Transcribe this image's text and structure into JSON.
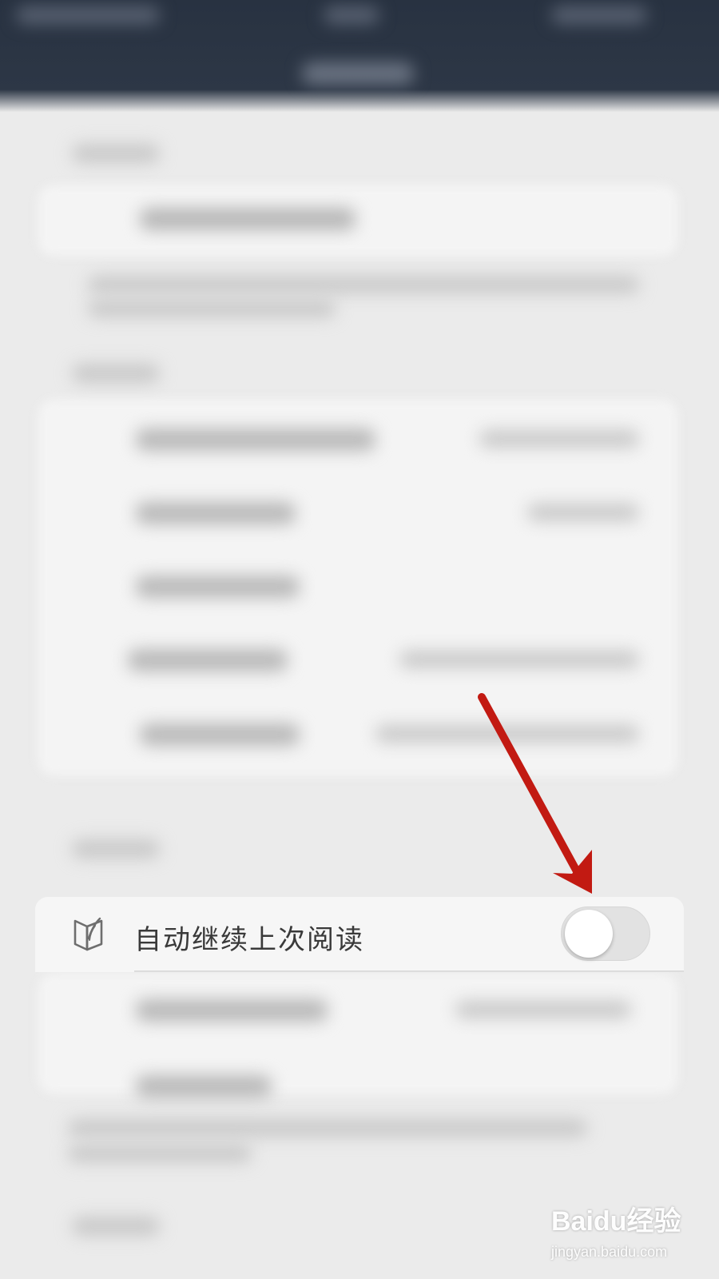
{
  "settings_row": {
    "label": "自动继续上次阅读",
    "icon": "book-icon",
    "toggle_state": "off"
  },
  "colors": {
    "header_bg": "#283241",
    "page_bg": "#ebebeb",
    "arrow": "#c21a12"
  },
  "watermark": {
    "brand": "Baidu经验",
    "url": "jingyan.baidu.com"
  }
}
